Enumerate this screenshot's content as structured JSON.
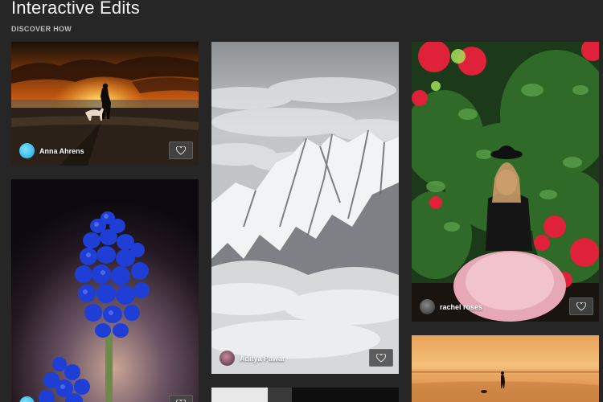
{
  "header": {
    "title": "Interactive Edits",
    "subtitle": "DISCOVER HOW"
  },
  "cards": [
    {
      "id": "sunset-beach",
      "author": "Anna Ahrens"
    },
    {
      "id": "blue-flower",
      "author": ""
    },
    {
      "id": "snow-mountains",
      "author": "Aditya Pawar"
    },
    {
      "id": "dark-strip",
      "author": ""
    },
    {
      "id": "woman-roses",
      "author": "rachel roses"
    },
    {
      "id": "golden-beach",
      "author": ""
    }
  ],
  "icons": {
    "like": "heart-icon",
    "avatar": "avatar"
  },
  "colors": {
    "background": "#262626",
    "card_button": "#464646",
    "text": "#ffffff"
  }
}
